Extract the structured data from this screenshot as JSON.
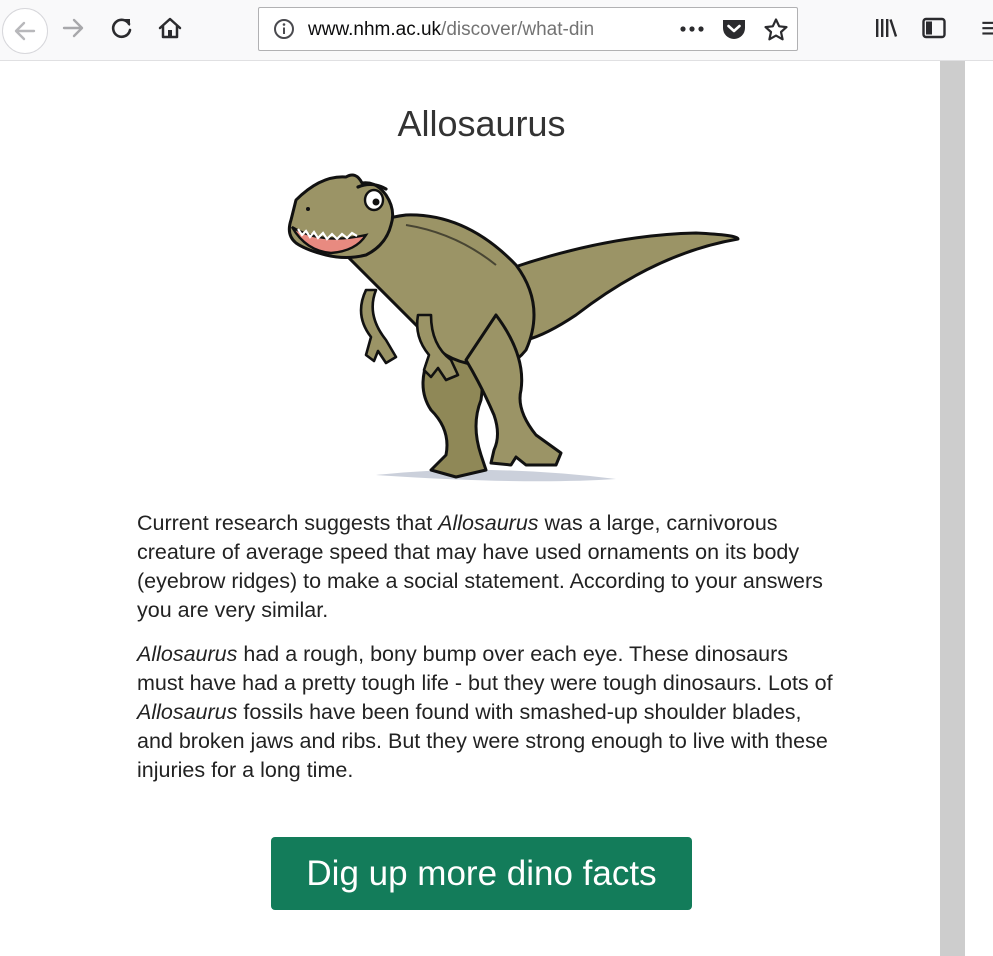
{
  "browser": {
    "url_host": "www.nhm.ac.uk",
    "url_path": "/discover/what-din",
    "icons": [
      "back-arrow-icon",
      "forward-arrow-icon",
      "reload-icon",
      "home-icon",
      "info-icon",
      "more-actions-icon",
      "pocket-icon",
      "bookmark-star-icon",
      "library-icon",
      "sidebar-icon",
      "menu-icon"
    ]
  },
  "page": {
    "title": "Allosaurus",
    "p1": {
      "a": "Current research suggests that ",
      "em1": "Allosaurus",
      "b": " was a large, carnivorous creature of average speed that may have used ornaments on its body (eyebrow ridges) to make a social statement. According to your answers you are very similar."
    },
    "p2": {
      "em1": "Allosaurus",
      "a": " had a rough, bony bump over each eye. These dinosaurs must have had a pretty tough life - but they were tough dinosaurs. Lots of ",
      "em2": "Allosaurus",
      "b": " fossils have been found with smashed-up shoulder blades, and broken jaws and ribs. But they were strong enough to live with these injuries for a long time."
    },
    "cta_label": "Dig up more dino facts"
  },
  "colors": {
    "button": "#137c5a",
    "dino_body": "#9b9466"
  }
}
